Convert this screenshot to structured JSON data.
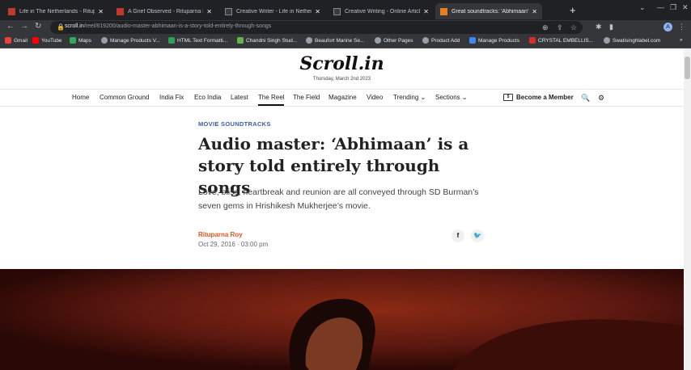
{
  "browser": {
    "tabs": [
      {
        "label": "Life in The Netherlands - Rituparna",
        "active": false
      },
      {
        "label": "A Grief Observed - Rituparna Roy",
        "active": false
      },
      {
        "label": "Creative Writer - Life in Netherla",
        "active": false
      },
      {
        "label": "Creative Writing - Online Articles",
        "active": false
      },
      {
        "label": "Great soundtracks: 'Abhimaan' is",
        "active": true
      }
    ],
    "url_domain": "scroll.in",
    "url_path": "/reel/819200/audio-master-abhimaan-is-a-story-told-entirely-through-songs",
    "profile_initial": "A",
    "bookmarks": [
      "Gmail",
      "YouTube",
      "Maps",
      "Manage Products V...",
      "HTML Text Formatti...",
      "Chandni Singh Stud...",
      "Beaufort Marine Se...",
      "Other Pages",
      "Product Add",
      "Manage Products",
      "CRYSTAL EMBELLIS...",
      "Swatisinghlabel.com"
    ]
  },
  "site": {
    "logo": "Scroll.in",
    "date": "Thursday, March 2nd 2023",
    "nav": [
      "Home",
      "Common Ground",
      "India Fix",
      "Eco India",
      "Latest",
      "The Reel",
      "The Field",
      "Magazine",
      "Video",
      "Trending",
      "Sections"
    ],
    "become_member": "Become a Member"
  },
  "article": {
    "kicker": "MOVIE SOUNDTRACKS",
    "headline": "Audio master: ‘Abhimaan’ is a story told entirely through songs",
    "dek": "Love, bliss, heartbreak and reunion are all conveyed through SD Burman’s seven gems in Hrishikesh Mukherjee’s movie.",
    "author": "Rituparna Roy",
    "date": "Oct 29, 2016 · 03:00 pm"
  },
  "colors": {
    "accent": "#3b5ba9",
    "author": "#e6531e",
    "hero": "#5c1810"
  }
}
